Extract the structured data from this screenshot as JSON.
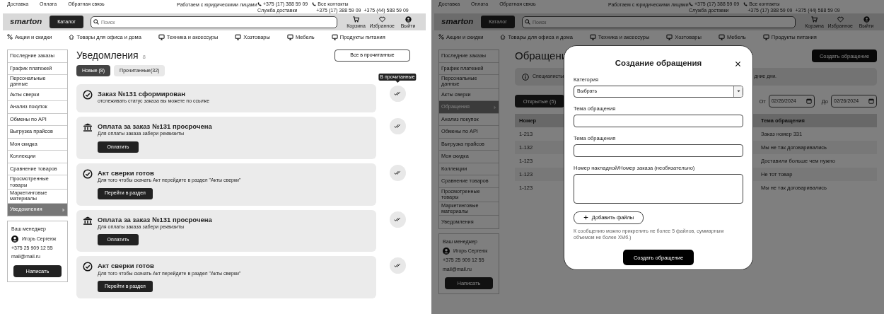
{
  "notifications_page": {
    "header": {
      "top_links": [
        "Доставка",
        "Оплата",
        "Обратная связь"
      ],
      "legal": "Работаем с юридическими лицами",
      "delivery": {
        "phone": "+375 (17) 388 59 09",
        "label": "Служба доставки"
      },
      "contacts": {
        "label": "Все контакты",
        "phones": [
          "+375 (17) 388 59 09",
          "+375 (44) 588 59 09"
        ]
      },
      "logo": "smarton",
      "catalog_button": "Каталог",
      "search_placeholder": "Поиск",
      "actions": [
        {
          "kind": "cart",
          "label": "Корзина"
        },
        {
          "kind": "heart",
          "label": "Избранное"
        },
        {
          "kind": "user",
          "label": "Выйти"
        }
      ],
      "categories": [
        {
          "kind": "percent",
          "label": "Акции и скидки"
        },
        {
          "kind": "home",
          "label": "Товары для офиса и дома"
        },
        {
          "kind": "monitor",
          "label": "Техника и аксессуры"
        },
        {
          "kind": "monitor",
          "label": "Хозтовары"
        },
        {
          "kind": "monitor",
          "label": "Мебель"
        },
        {
          "kind": "monitor",
          "label": "Продукты питания"
        }
      ]
    },
    "sidebar": {
      "items": [
        {
          "label": "Последние заказы",
          "selected": false
        },
        {
          "label": "График платежей",
          "selected": false
        },
        {
          "label": "Персональные данные",
          "selected": false
        },
        {
          "label": "Акты сверки",
          "selected": false
        },
        {
          "label": "Анализ покупок",
          "selected": false
        },
        {
          "label": "Обмены по API",
          "selected": false
        },
        {
          "label": "Выгрузка прайсов",
          "selected": false
        },
        {
          "label": "Моя скидка",
          "selected": false
        },
        {
          "label": "Коллекции",
          "selected": false
        },
        {
          "label": "Сравнение товаров",
          "selected": false
        },
        {
          "label": "Просмотренные товары",
          "selected": false
        },
        {
          "label": "Маркетинговые материалы",
          "selected": false
        },
        {
          "label": "Уведомления",
          "selected": true
        }
      ]
    },
    "manager": {
      "title": "Ваш менеджер",
      "name": "Игорь Сергеюк",
      "phone": "+375 25 909 12 55",
      "email": "mail@mail.ru",
      "button": "Написать"
    },
    "title": "Уведомления",
    "count": "8",
    "mark_all_button": "Все в прочитанные",
    "tabs": [
      {
        "label": "Новые (8)",
        "selected": true
      },
      {
        "label": "Прочитанные(32)",
        "selected": false
      }
    ],
    "notifications": [
      {
        "kind": "check",
        "title": "Заказ №131 сформирован",
        "text": "отслеживать статус заказа вы можете по ссылке",
        "tooltip": "В прочитанные"
      },
      {
        "kind": "bank",
        "title": "Оплата за заказ №131 просрочена",
        "text": "Для оплаты заказа забери реквизиты",
        "button": "Оплатить"
      },
      {
        "kind": "check",
        "title": "Акт сверки готов",
        "text": "Для того чтобы скачать Акт перейдите в раздел \"Акты сверки\"",
        "button": "Перейти в раздел"
      },
      {
        "kind": "bank",
        "title": "Оплата за заказ №131 просрочена",
        "text": "Для оплаты заказа забери реквизиты",
        "button": "Оплатить"
      },
      {
        "kind": "check",
        "title": "Акт сверки готов",
        "text": "Для того чтобы скачать Акт перейдите в раздел \"Акты сверки\"",
        "button": "Перейти в раздел"
      }
    ]
  },
  "requests_page": {
    "header": {
      "top_links": [
        "Доставка",
        "Оплата",
        "Обратная связь"
      ],
      "legal": "Работаем с юридическими лицами",
      "delivery": {
        "phone": "+375 (17) 388 59 09",
        "label": "Служба доставки"
      },
      "contacts": {
        "label": "Все контакты",
        "phones": [
          "+375 (17) 388 59 09",
          "+375 (44) 588 59 09"
        ]
      },
      "logo": "smarton",
      "catalog_button": "Каталог",
      "search_placeholder": "Поиск",
      "actions": [
        {
          "kind": "cart",
          "label": "Корзина"
        },
        {
          "kind": "heart",
          "label": "Избранное"
        },
        {
          "kind": "user",
          "label": "Выйти"
        }
      ],
      "categories": [
        {
          "kind": "percent",
          "label": "Акции и скидки"
        },
        {
          "kind": "home",
          "label": "Товары для офиса и дома"
        },
        {
          "kind": "monitor",
          "label": "Техника и аксессуры"
        },
        {
          "kind": "monitor",
          "label": "Хозтовары"
        },
        {
          "kind": "monitor",
          "label": "Мебель"
        },
        {
          "kind": "monitor",
          "label": "Продукты питания"
        }
      ]
    },
    "sidebar": {
      "items": [
        {
          "label": "Последние заказы",
          "selected": false
        },
        {
          "label": "График платежей",
          "selected": false
        },
        {
          "label": "Персональные данные",
          "selected": false
        },
        {
          "label": "Акты сверки",
          "selected": false
        },
        {
          "label": "Обращения",
          "selected": true
        },
        {
          "label": "Анализ покупок",
          "selected": false
        },
        {
          "label": "Обмены по API",
          "selected": false
        },
        {
          "label": "Выгрузка прайсов",
          "selected": false
        },
        {
          "label": "Моя скидка",
          "selected": false
        },
        {
          "label": "Коллекции",
          "selected": false
        },
        {
          "label": "Сравнение товаров",
          "selected": false
        },
        {
          "label": "Просмотренные товары",
          "selected": false
        },
        {
          "label": "Маркетинговые материалы",
          "selected": false
        },
        {
          "label": "Уведомления",
          "selected": false
        }
      ]
    },
    "manager": {
      "title": "Ваш менеджер",
      "name": "Игорь Сергеюк",
      "phone": "+375 25 909 12 55",
      "email": "mail@mail.ru",
      "button": "Написать"
    },
    "title": "Обращени",
    "create_button": "Создать обращение",
    "info_start": "Специалисты",
    "info_end": "дние дни.",
    "tabs": [
      {
        "label": "Открытые (5)",
        "selected": true
      }
    ],
    "date_from": {
      "label": "От",
      "value": "02/26/2024"
    },
    "date_to": {
      "label": "До",
      "value": "02/26/2024"
    },
    "table": {
      "columns": [
        "Номер",
        "Тема обращения"
      ],
      "rows": [
        [
          "1-213",
          "Заказ номер 331"
        ],
        [
          "1-132",
          "Мы не так договаривались"
        ],
        [
          "1-123",
          "Доставили больше чем нужно"
        ],
        [
          "1-123",
          "Не тот товар"
        ],
        [
          "1-123",
          "Мы не так договаривались"
        ]
      ]
    },
    "modal": {
      "title": "Создание обращения",
      "category_label": "Категория",
      "category_value": "Выбрать",
      "fields": [
        {
          "kind": "input",
          "label": "Тема обращения"
        },
        {
          "kind": "input",
          "label": "Тема обращения"
        },
        {
          "kind": "textarea",
          "label": "Номер накладной/Номер заказа (необязательно)"
        }
      ],
      "add_files_button": "Добавить файлы",
      "note": "К сообщению можно прикрепить не более 5 файлов, суммарным объемом не более ХМб.)",
      "submit_button": "Создать обращение"
    }
  }
}
